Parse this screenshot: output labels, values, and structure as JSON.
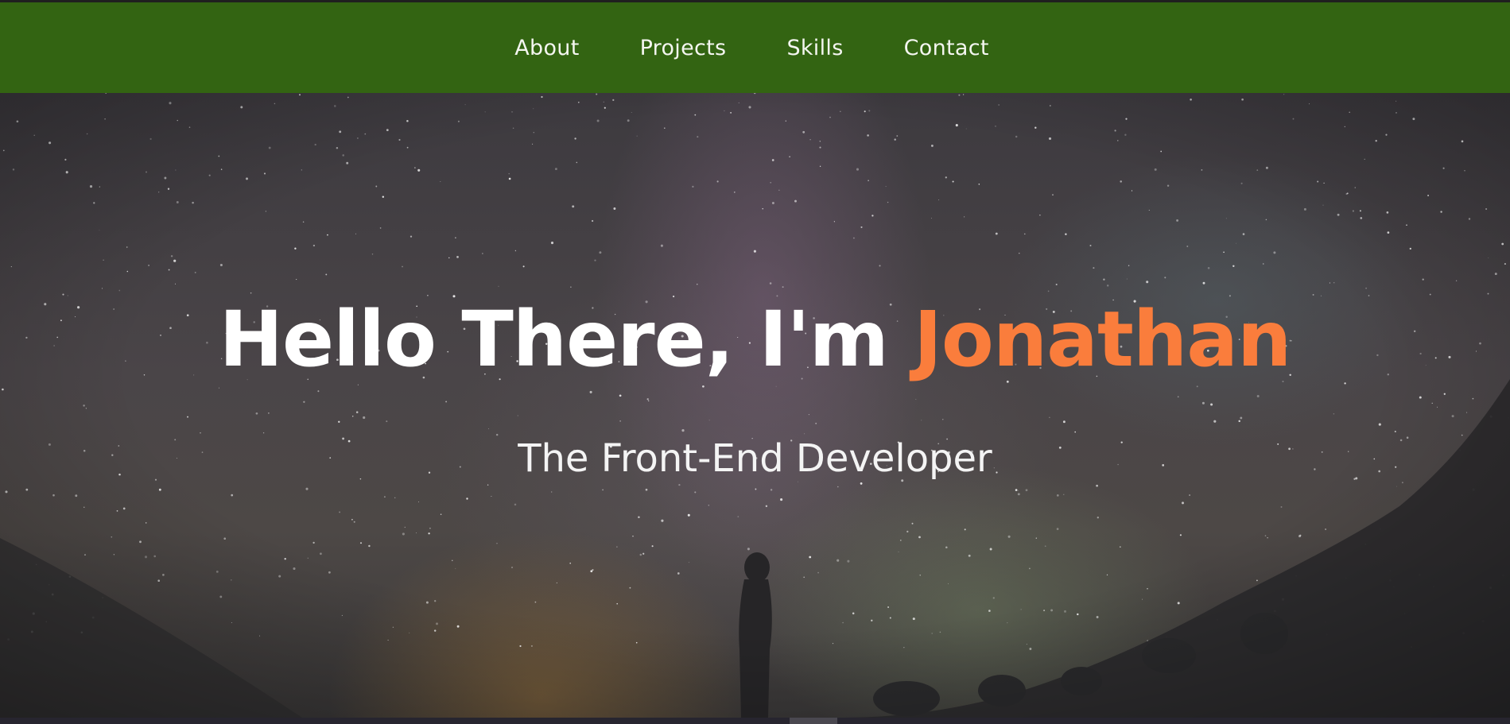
{
  "nav": {
    "items": [
      {
        "label": "About"
      },
      {
        "label": "Projects"
      },
      {
        "label": "Skills"
      },
      {
        "label": "Contact"
      }
    ]
  },
  "hero": {
    "greeting": "Hello There, I'm ",
    "name": "Jonathan",
    "subtitle": "The Front-End Developer"
  },
  "colors": {
    "navbar": "#336412",
    "accent": "#fa7d3c",
    "text": "#ffffff"
  }
}
